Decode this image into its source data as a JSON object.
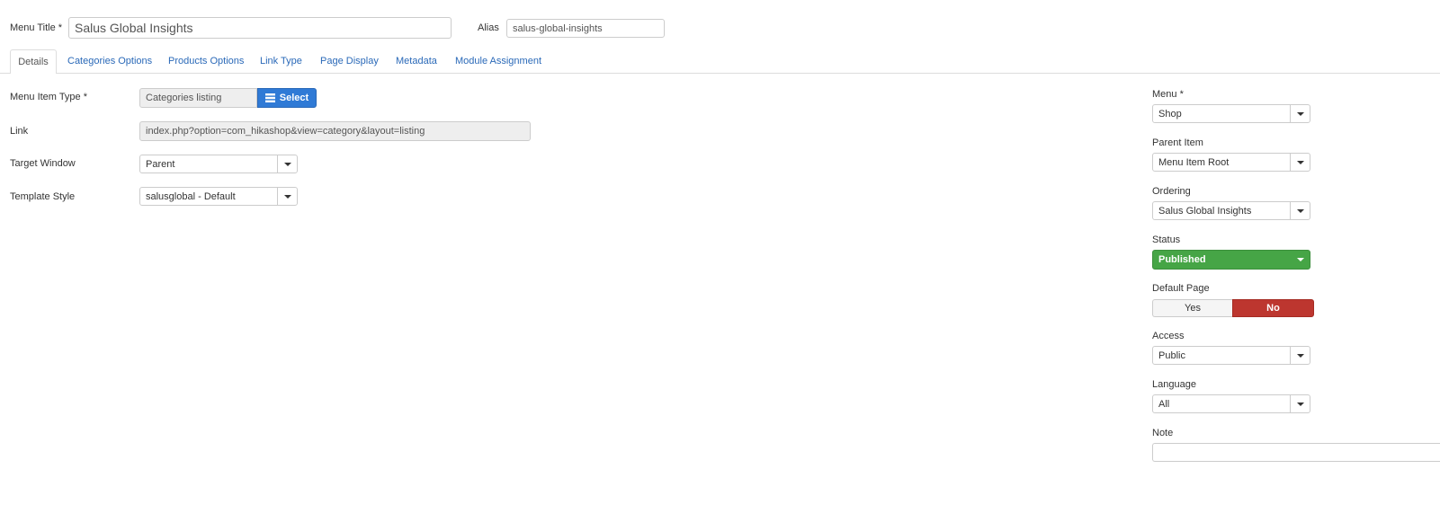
{
  "menu_title": {
    "label": "Menu Title *",
    "value": "Salus Global Insights"
  },
  "alias": {
    "label": "Alias",
    "value": "salus-global-insights"
  },
  "tabs": [
    {
      "label": "Details"
    },
    {
      "label": "Categories Options"
    },
    {
      "label": "Products Options"
    },
    {
      "label": "Link Type"
    },
    {
      "label": "Page Display"
    },
    {
      "label": "Metadata"
    },
    {
      "label": "Module Assignment"
    }
  ],
  "details": {
    "menu_item_type": {
      "label": "Menu Item Type *",
      "value": "Categories listing",
      "button": "Select"
    },
    "link": {
      "label": "Link",
      "value": "index.php?option=com_hikashop&view=category&layout=listing"
    },
    "target_window": {
      "label": "Target Window",
      "value": "Parent"
    },
    "template_style": {
      "label": "Template Style",
      "value": "salusglobal - Default"
    }
  },
  "sidebar": {
    "menu": {
      "label": "Menu *",
      "value": "Shop"
    },
    "parent_item": {
      "label": "Parent Item",
      "value": "Menu Item Root"
    },
    "ordering": {
      "label": "Ordering",
      "value": "Salus Global Insights"
    },
    "status": {
      "label": "Status",
      "value": "Published",
      "color": "#46a546"
    },
    "default_page": {
      "label": "Default Page",
      "yes": "Yes",
      "no": "No",
      "active": "No",
      "active_color": "#bd362f"
    },
    "access": {
      "label": "Access",
      "value": "Public"
    },
    "language": {
      "label": "Language",
      "value": "All"
    },
    "note": {
      "label": "Note",
      "value": ""
    }
  },
  "colors": {
    "accent": "#2f7ad6",
    "link": "#2a69b8"
  }
}
